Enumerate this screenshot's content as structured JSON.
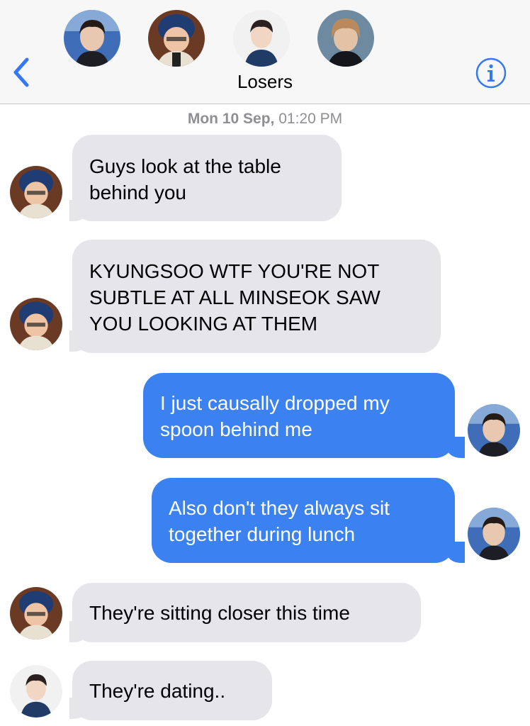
{
  "header": {
    "title": "Losers",
    "back_icon": "chevron-left-icon",
    "info_icon": "info-icon",
    "accent": "#3478f6",
    "participants": [
      {
        "avatar": "avatar-kyungsoo"
      },
      {
        "avatar": "avatar-chanyeol"
      },
      {
        "avatar": "avatar-sehun"
      },
      {
        "avatar": "avatar-baekhyun"
      }
    ]
  },
  "timestamp": {
    "day": "Mon 10 Sep,",
    "time": "01:20 PM"
  },
  "messages": [
    {
      "direction": "incoming",
      "lines": [
        "Guys look at the table",
        "behind you"
      ]
    },
    {
      "direction": "incoming",
      "lines": [
        "KYUNGSOO WTF YOU'RE NOT",
        "SUBTLE AT ALL MINSEOK SAW",
        "YOU LOOKING AT THEM"
      ]
    },
    {
      "direction": "outgoing",
      "lines": [
        "I just causally dropped my",
        "spoon behind me"
      ]
    },
    {
      "direction": "outgoing",
      "lines": [
        "Also don't they always sit",
        "together during lunch"
      ]
    },
    {
      "direction": "incoming",
      "lines": [
        "They're sitting closer this time"
      ]
    },
    {
      "direction": "incoming",
      "lines": [
        "They're dating.."
      ]
    }
  ],
  "colors": {
    "incoming_bubble": "#e5e5ea",
    "outgoing_bubble": "#3b82f0",
    "header_bg": "#f7f7f7"
  }
}
